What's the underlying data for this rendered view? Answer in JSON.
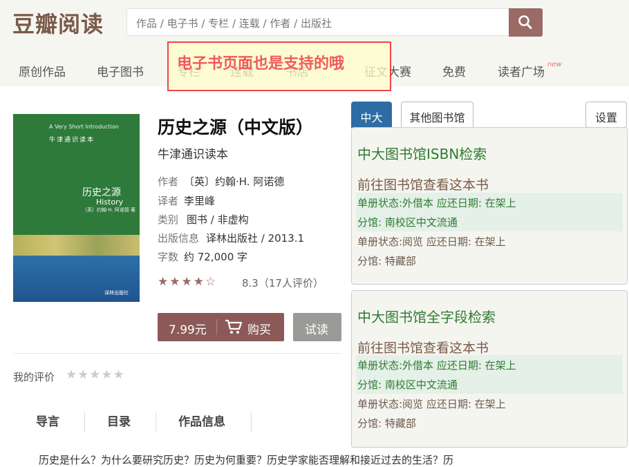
{
  "header": {
    "logo": "豆瓣阅读",
    "search_placeholder": "作品 / 电子书 / 专栏 / 连载 / 作者 / 出版社"
  },
  "nav": {
    "items": [
      "原创作品",
      "电子图书",
      "专栏",
      "连载",
      "书店",
      "征文大赛",
      "免费",
      "读者广场"
    ],
    "new_badge": "new"
  },
  "overlay": {
    "text": "电子书页面也是支持的哦"
  },
  "book": {
    "cover": {
      "series_en": "A Very Short Introduction",
      "series_cn": "牛津通识读本",
      "title_cn": "历史之源",
      "title_en": "History",
      "author_line": "〔英〕约翰·H. 阿诺德 著",
      "publisher": "译林出版社"
    },
    "title": "历史之源（中文版）",
    "subtitle": "牛津通识读本",
    "meta": [
      {
        "label": "作者",
        "value": "〔英〕约翰·H. 阿诺德"
      },
      {
        "label": "译者",
        "value": "李里峰"
      },
      {
        "label": "类别",
        "value": "图书 / 非虚构"
      },
      {
        "label": "出版信息",
        "value": "译林出版社 / 2013.1"
      },
      {
        "label": "字数",
        "value": "约 72,000 字"
      }
    ],
    "stars": "★★★★☆",
    "rating": 3.5,
    "rating_text": "8.3（17人评价）",
    "price": "7.99元",
    "buy_label": "购买",
    "try_label": "试读"
  },
  "my_rating": {
    "label": "我的评价",
    "stars": "★★★★★"
  },
  "tabs": [
    "导言",
    "目录",
    "作品信息"
  ],
  "intro_text": "历史是什么？为什么要研究历史？历史为何重要？历史学家能否理解和接近过去的生活？历",
  "library": {
    "tabs": {
      "active": "中大",
      "other": "其他图书馆",
      "settings": "设置"
    },
    "panels": [
      {
        "heading": "中大图书馆ISBN检索",
        "link": "前往图书馆查看这本书",
        "rows": [
          "单册状态:外借本 应还日期: 在架上",
          "分馆: 南校区中文流通",
          "单册状态:阅览 应还日期: 在架上",
          "分馆: 特藏部"
        ]
      },
      {
        "heading": "中大图书馆全字段检索",
        "link": "前往图书馆查看这本书",
        "rows": [
          "单册状态:外借本 应还日期: 在架上",
          "分馆: 南校区中文流通",
          "单册状态:阅览 应还日期: 在架上",
          "分馆: 特藏部"
        ]
      }
    ]
  },
  "colors": {
    "accent": "#8b5a58",
    "tab_blue": "#2e6da4",
    "green_text": "#2f7b31"
  }
}
